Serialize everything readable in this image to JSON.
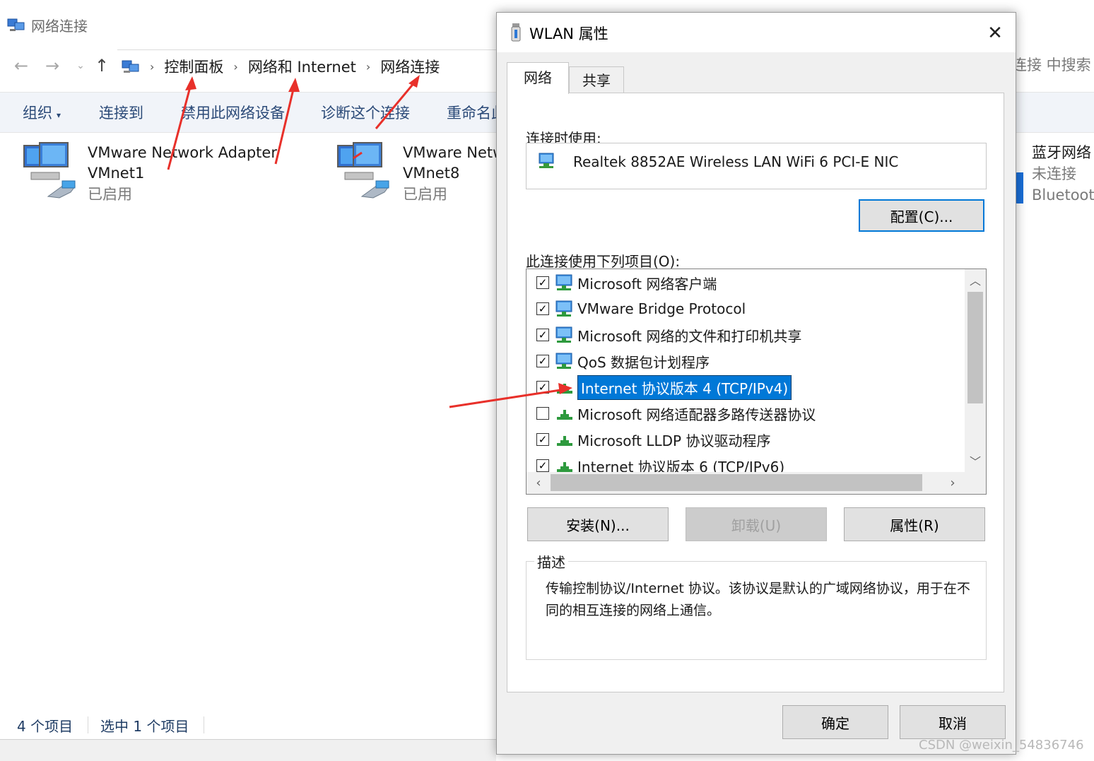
{
  "explorer": {
    "title": "网络连接",
    "breadcrumb": [
      "控制面板",
      "网络和 Internet",
      "网络连接"
    ],
    "search_hint": "连接 中搜索",
    "toolbar": {
      "organize": "组织",
      "connect_to": "连接到",
      "disable": "禁用此网络设备",
      "diagnose": "诊断这个连接",
      "rename": "重命名此"
    },
    "items": [
      {
        "name1": "VMware Network Adapter",
        "name2": "VMnet1",
        "status": "已启用"
      },
      {
        "name1": "VMware Netw",
        "name2": "VMnet8",
        "status": "已启用"
      },
      {
        "name1": "蓝牙网络",
        "name2": "未连接",
        "status": "Bluetoot"
      }
    ],
    "status": {
      "count": "4 个项目",
      "selected": "选中 1 个项目"
    }
  },
  "dialog": {
    "title": "WLAN 属性",
    "close_glyph": "✕",
    "tabs": [
      "网络",
      "共享"
    ],
    "connect_using_label": "连接时使用:",
    "adapter_name": "Realtek 8852AE Wireless LAN WiFi 6 PCI-E NIC",
    "configure_button": "配置(C)...",
    "items_label": "此连接使用下列项目(O):",
    "components": [
      {
        "label": "Microsoft 网络客户端",
        "checked": true,
        "icon": "network-client-icon"
      },
      {
        "label": "VMware Bridge Protocol",
        "checked": true,
        "icon": "network-client-icon"
      },
      {
        "label": "Microsoft 网络的文件和打印机共享",
        "checked": true,
        "icon": "network-client-icon"
      },
      {
        "label": "QoS 数据包计划程序",
        "checked": true,
        "icon": "network-client-icon"
      },
      {
        "label": "Internet 协议版本 4 (TCP/IPv4)",
        "checked": true,
        "selected": true,
        "icon": "protocol-icon"
      },
      {
        "label": "Microsoft 网络适配器多路传送器协议",
        "checked": false,
        "icon": "protocol-icon"
      },
      {
        "label": "Microsoft LLDP 协议驱动程序",
        "checked": true,
        "icon": "protocol-icon"
      },
      {
        "label": "Internet 协议版本 6 (TCP/IPv6)",
        "checked": true,
        "icon": "protocol-icon"
      }
    ],
    "install_button": "安装(N)...",
    "uninstall_button": "卸载(U)",
    "properties_button": "属性(R)",
    "description_legend": "描述",
    "description_text": "传输控制协议/Internet 协议。该协议是默认的广域网络协议，用于在不同的相互连接的网络上通信。",
    "ok_button": "确定",
    "cancel_button": "取消"
  },
  "annotation_color": "#e8302a",
  "selection_color": "#0078d7",
  "watermark": "CSDN @weixin_54836746"
}
